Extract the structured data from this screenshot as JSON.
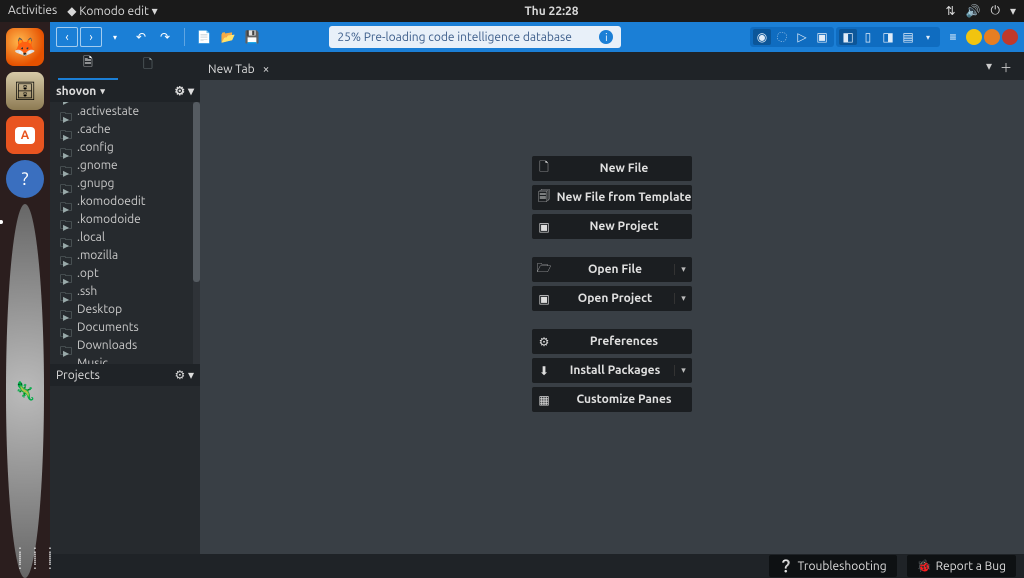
{
  "gnome": {
    "activities": "Activities",
    "app_menu": "Komodo edit ▾",
    "clock": "Thu 22:28"
  },
  "launcher": {
    "items": [
      "firefox",
      "files",
      "software",
      "help",
      "komodo"
    ]
  },
  "toolbar": {
    "status_text": "25% Pre-loading code intelligence database"
  },
  "tabs": {
    "editor_tab": "New Tab"
  },
  "sidebar": {
    "root_label": "shovon",
    "projects_label": "Projects",
    "items": [
      {
        "name": ".activestate",
        "type": "folder"
      },
      {
        "name": ".cache",
        "type": "folder"
      },
      {
        "name": ".config",
        "type": "folder"
      },
      {
        "name": ".gnome",
        "type": "folder"
      },
      {
        "name": ".gnupg",
        "type": "folder"
      },
      {
        "name": ".komodoedit",
        "type": "folder"
      },
      {
        "name": ".komodoide",
        "type": "folder"
      },
      {
        "name": ".local",
        "type": "folder"
      },
      {
        "name": ".mozilla",
        "type": "folder"
      },
      {
        "name": ".opt",
        "type": "folder"
      },
      {
        "name": ".ssh",
        "type": "folder"
      },
      {
        "name": "Desktop",
        "type": "folder"
      },
      {
        "name": "Documents",
        "type": "folder"
      },
      {
        "name": "Downloads",
        "type": "folder"
      },
      {
        "name": "Music",
        "type": "folder"
      }
    ]
  },
  "start": {
    "new_file": "New File",
    "new_file_tpl": "New File from Template",
    "new_project": "New Project",
    "open_file": "Open File",
    "open_project": "Open Project",
    "preferences": "Preferences",
    "install_packages": "Install Packages",
    "customize_panes": "Customize Panes"
  },
  "status": {
    "troubleshooting": "Troubleshooting",
    "report_bug": "Report a Bug"
  }
}
